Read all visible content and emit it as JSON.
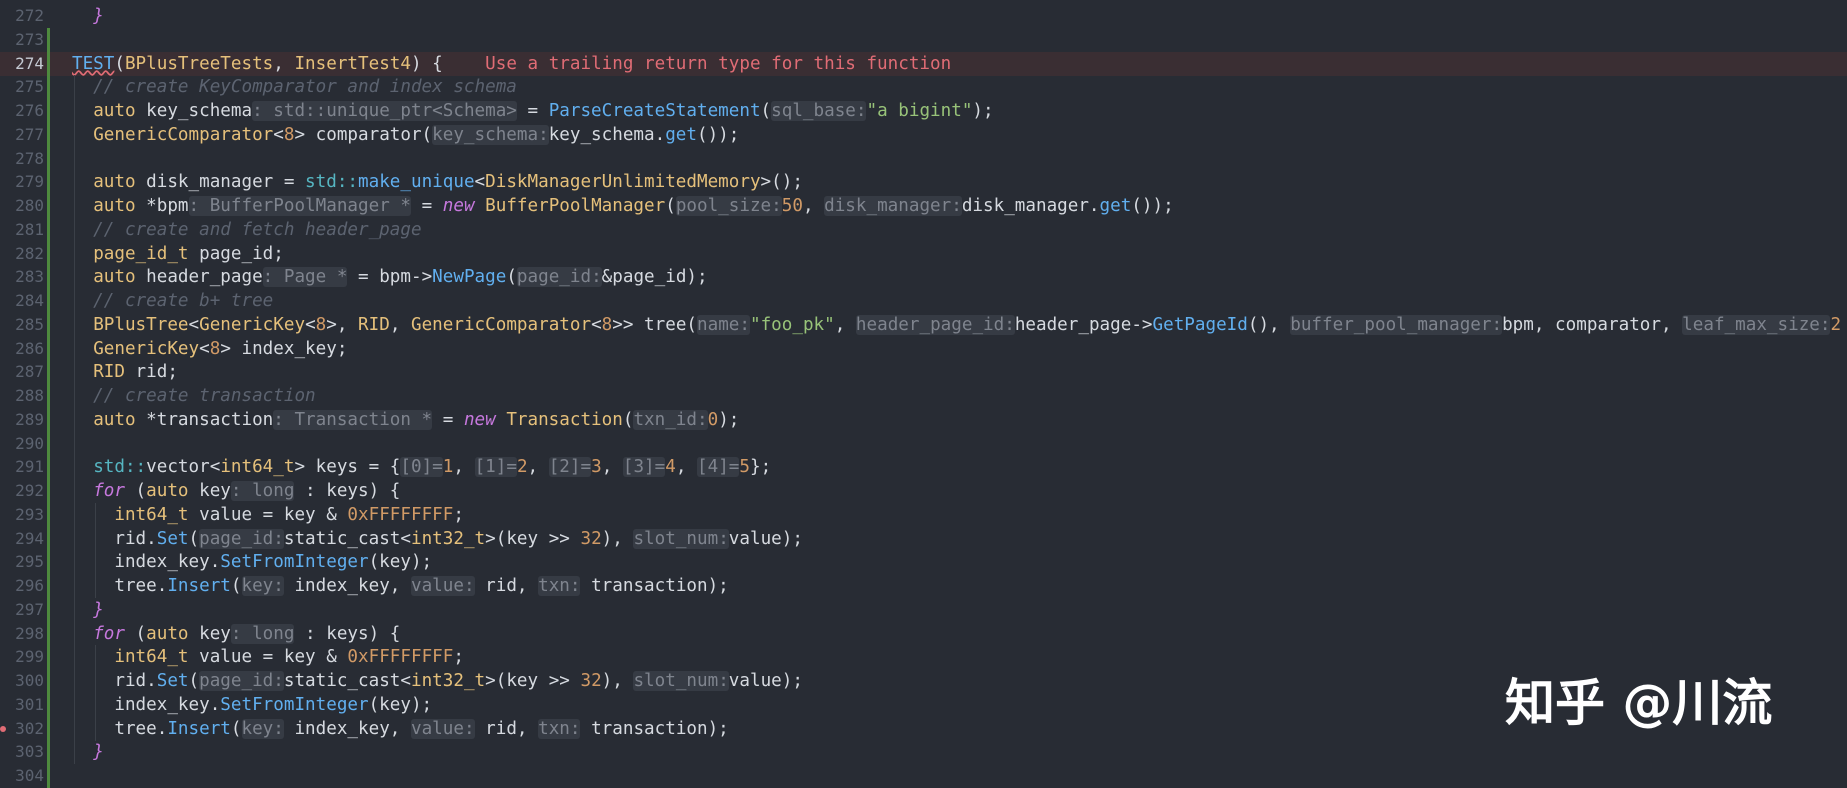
{
  "editor": {
    "lines": [
      {
        "n": "272",
        "tokens": [
          [
            "t-text",
            "  "
          ],
          [
            "t-kwi",
            "}"
          ]
        ]
      },
      {
        "n": "273",
        "tokens": []
      },
      {
        "n": "274",
        "active": true,
        "tokens": [
          [
            "t-macro",
            "TEST"
          ],
          [
            "t-text",
            "("
          ],
          [
            "t-type",
            "BPlusTreeTests"
          ],
          [
            "t-text",
            ", "
          ],
          [
            "t-type",
            "InsertTest4"
          ],
          [
            "t-text",
            ") {    "
          ],
          [
            "t-err",
            "Use a trailing return type for this function"
          ]
        ]
      },
      {
        "n": "275",
        "tokens": [
          [
            "t-com",
            "  // create KeyComparator and index schema"
          ]
        ]
      },
      {
        "n": "276",
        "tokens": [
          [
            "t-text",
            "  "
          ],
          [
            "t-kw",
            "auto"
          ],
          [
            "t-text",
            " key_schema"
          ],
          [
            "t-hint",
            ": std::unique_ptr<Schema>"
          ],
          [
            "t-text",
            " = "
          ],
          [
            "t-fn",
            "ParseCreateStatement"
          ],
          [
            "t-text",
            "("
          ],
          [
            "t-hint",
            "sql_base:"
          ],
          [
            "t-str",
            "\"a bigint\""
          ],
          [
            "t-text",
            ");"
          ]
        ]
      },
      {
        "n": "277",
        "tokens": [
          [
            "t-text",
            "  "
          ],
          [
            "t-type",
            "GenericComparator"
          ],
          [
            "t-text",
            "<"
          ],
          [
            "t-num",
            "8"
          ],
          [
            "t-text",
            "> comparator("
          ],
          [
            "t-hint",
            "key_schema:"
          ],
          [
            "t-text",
            "key_schema."
          ],
          [
            "t-fn",
            "get"
          ],
          [
            "t-text",
            "());"
          ]
        ]
      },
      {
        "n": "278",
        "tokens": []
      },
      {
        "n": "279",
        "tokens": [
          [
            "t-text",
            "  "
          ],
          [
            "t-kw",
            "auto"
          ],
          [
            "t-text",
            " disk_manager = "
          ],
          [
            "t-ns",
            "std::"
          ],
          [
            "t-fn",
            "make_unique"
          ],
          [
            "t-text",
            "<"
          ],
          [
            "t-type",
            "DiskManagerUnlimitedMemory"
          ],
          [
            "t-text",
            ">();"
          ]
        ]
      },
      {
        "n": "280",
        "tokens": [
          [
            "t-text",
            "  "
          ],
          [
            "t-kw",
            "auto"
          ],
          [
            "t-text",
            " *bpm"
          ],
          [
            "t-hint",
            ": BufferPoolManager *"
          ],
          [
            "t-text",
            " = "
          ],
          [
            "t-kwi",
            "new"
          ],
          [
            "t-text",
            " "
          ],
          [
            "t-type",
            "BufferPoolManager"
          ],
          [
            "t-text",
            "("
          ],
          [
            "t-hint",
            "pool_size:"
          ],
          [
            "t-num",
            "50"
          ],
          [
            "t-text",
            ", "
          ],
          [
            "t-hint",
            "disk_manager:"
          ],
          [
            "t-text",
            "disk_manager."
          ],
          [
            "t-fn",
            "get"
          ],
          [
            "t-text",
            "());"
          ]
        ]
      },
      {
        "n": "281",
        "tokens": [
          [
            "t-com",
            "  // create and fetch header_page"
          ]
        ]
      },
      {
        "n": "282",
        "tokens": [
          [
            "t-text",
            "  "
          ],
          [
            "t-type",
            "page_id_t"
          ],
          [
            "t-text",
            " page_id;"
          ]
        ]
      },
      {
        "n": "283",
        "tokens": [
          [
            "t-text",
            "  "
          ],
          [
            "t-kw",
            "auto"
          ],
          [
            "t-text",
            " header_page"
          ],
          [
            "t-hint",
            ": Page *"
          ],
          [
            "t-text",
            " = bpm->"
          ],
          [
            "t-fn",
            "NewPage"
          ],
          [
            "t-text",
            "("
          ],
          [
            "t-hint",
            "page_id:"
          ],
          [
            "t-text",
            "&page_id);"
          ]
        ]
      },
      {
        "n": "284",
        "tokens": [
          [
            "t-com",
            "  // create b+ tree"
          ]
        ]
      },
      {
        "n": "285",
        "tokens": [
          [
            "t-text",
            "  "
          ],
          [
            "t-type",
            "BPlusTree"
          ],
          [
            "t-text",
            "<"
          ],
          [
            "t-type",
            "GenericKey"
          ],
          [
            "t-text",
            "<"
          ],
          [
            "t-num",
            "8"
          ],
          [
            "t-text",
            ">, "
          ],
          [
            "t-type",
            "RID"
          ],
          [
            "t-text",
            ", "
          ],
          [
            "t-type",
            "GenericComparator"
          ],
          [
            "t-text",
            "<"
          ],
          [
            "t-num",
            "8"
          ],
          [
            "t-text",
            ">> tree("
          ],
          [
            "t-hint",
            "name:"
          ],
          [
            "t-str",
            "\"foo_pk\""
          ],
          [
            "t-text",
            ", "
          ],
          [
            "t-hint",
            "header_page_id:"
          ],
          [
            "t-text",
            "header_page->"
          ],
          [
            "t-fn",
            "GetPageId"
          ],
          [
            "t-text",
            "(), "
          ],
          [
            "t-hint",
            "buffer_pool_manager:"
          ],
          [
            "t-text",
            "bpm, comparator, "
          ],
          [
            "t-hint",
            "leaf_max_size:"
          ],
          [
            "t-num",
            "2"
          ]
        ]
      },
      {
        "n": "286",
        "tokens": [
          [
            "t-text",
            "  "
          ],
          [
            "t-type",
            "GenericKey"
          ],
          [
            "t-text",
            "<"
          ],
          [
            "t-num",
            "8"
          ],
          [
            "t-text",
            "> index_key;"
          ]
        ]
      },
      {
        "n": "287",
        "tokens": [
          [
            "t-text",
            "  "
          ],
          [
            "t-type",
            "RID"
          ],
          [
            "t-text",
            " rid;"
          ]
        ]
      },
      {
        "n": "288",
        "tokens": [
          [
            "t-com",
            "  // create transaction"
          ]
        ]
      },
      {
        "n": "289",
        "tokens": [
          [
            "t-text",
            "  "
          ],
          [
            "t-kw",
            "auto"
          ],
          [
            "t-text",
            " *transaction"
          ],
          [
            "t-hint",
            ": Transaction *"
          ],
          [
            "t-text",
            " = "
          ],
          [
            "t-kwi",
            "new"
          ],
          [
            "t-text",
            " "
          ],
          [
            "t-type",
            "Transaction"
          ],
          [
            "t-text",
            "("
          ],
          [
            "t-hint",
            "txn_id:"
          ],
          [
            "t-num",
            "0"
          ],
          [
            "t-text",
            ");"
          ]
        ]
      },
      {
        "n": "290",
        "tokens": []
      },
      {
        "n": "291",
        "tokens": [
          [
            "t-text",
            "  "
          ],
          [
            "t-ns",
            "std::"
          ],
          [
            "t-text",
            "vector<"
          ],
          [
            "t-type",
            "int64_t"
          ],
          [
            "t-text",
            "> keys = {"
          ],
          [
            "t-hint",
            "[0]="
          ],
          [
            "t-num",
            "1"
          ],
          [
            "t-text",
            ", "
          ],
          [
            "t-hint",
            "[1]="
          ],
          [
            "t-num",
            "2"
          ],
          [
            "t-text",
            ", "
          ],
          [
            "t-hint",
            "[2]="
          ],
          [
            "t-num",
            "3"
          ],
          [
            "t-text",
            ", "
          ],
          [
            "t-hint",
            "[3]="
          ],
          [
            "t-num",
            "4"
          ],
          [
            "t-text",
            ", "
          ],
          [
            "t-hint",
            "[4]="
          ],
          [
            "t-num",
            "5"
          ],
          [
            "t-text",
            "};"
          ]
        ]
      },
      {
        "n": "292",
        "tokens": [
          [
            "t-text",
            "  "
          ],
          [
            "t-kwi",
            "for"
          ],
          [
            "t-text",
            " ("
          ],
          [
            "t-kw",
            "auto"
          ],
          [
            "t-text",
            " key"
          ],
          [
            "t-hint",
            ": long"
          ],
          [
            "t-text",
            " : keys) {"
          ]
        ]
      },
      {
        "n": "293",
        "tokens": [
          [
            "t-text",
            "    "
          ],
          [
            "t-type",
            "int64_t"
          ],
          [
            "t-text",
            " value = key & "
          ],
          [
            "t-num",
            "0xFFFFFFFF"
          ],
          [
            "t-text",
            ";"
          ]
        ]
      },
      {
        "n": "294",
        "tokens": [
          [
            "t-text",
            "    rid."
          ],
          [
            "t-fn",
            "Set"
          ],
          [
            "t-text",
            "("
          ],
          [
            "t-hint",
            "page_id:"
          ],
          [
            "t-text",
            "static_cast<"
          ],
          [
            "t-type",
            "int32_t"
          ],
          [
            "t-text",
            ">(key >> "
          ],
          [
            "t-num",
            "32"
          ],
          [
            "t-text",
            "), "
          ],
          [
            "t-hint",
            "slot_num:"
          ],
          [
            "t-text",
            "value);"
          ]
        ]
      },
      {
        "n": "295",
        "tokens": [
          [
            "t-text",
            "    index_key."
          ],
          [
            "t-fn",
            "SetFromInteger"
          ],
          [
            "t-text",
            "(key);"
          ]
        ]
      },
      {
        "n": "296",
        "tokens": [
          [
            "t-text",
            "    tree."
          ],
          [
            "t-fn",
            "Insert"
          ],
          [
            "t-text",
            "("
          ],
          [
            "t-hint",
            "key:"
          ],
          [
            "t-text",
            " index_key, "
          ],
          [
            "t-hint",
            "value:"
          ],
          [
            "t-text",
            " rid, "
          ],
          [
            "t-hint",
            "txn:"
          ],
          [
            "t-text",
            " transaction);"
          ]
        ]
      },
      {
        "n": "297",
        "tokens": [
          [
            "t-text",
            "  "
          ],
          [
            "t-kwi",
            "}"
          ]
        ]
      },
      {
        "n": "298",
        "tokens": [
          [
            "t-text",
            "  "
          ],
          [
            "t-kwi",
            "for"
          ],
          [
            "t-text",
            " ("
          ],
          [
            "t-kw",
            "auto"
          ],
          [
            "t-text",
            " key"
          ],
          [
            "t-hint",
            ": long"
          ],
          [
            "t-text",
            " : keys) {"
          ]
        ]
      },
      {
        "n": "299",
        "tokens": [
          [
            "t-text",
            "    "
          ],
          [
            "t-type",
            "int64_t"
          ],
          [
            "t-text",
            " value = key & "
          ],
          [
            "t-num",
            "0xFFFFFFFF"
          ],
          [
            "t-text",
            ";"
          ]
        ]
      },
      {
        "n": "300",
        "tokens": [
          [
            "t-text",
            "    rid."
          ],
          [
            "t-fn",
            "Set"
          ],
          [
            "t-text",
            "("
          ],
          [
            "t-hint",
            "page_id:"
          ],
          [
            "t-text",
            "static_cast<"
          ],
          [
            "t-type",
            "int32_t"
          ],
          [
            "t-text",
            ">(key >> "
          ],
          [
            "t-num",
            "32"
          ],
          [
            "t-text",
            "), "
          ],
          [
            "t-hint",
            "slot_num:"
          ],
          [
            "t-text",
            "value);"
          ]
        ]
      },
      {
        "n": "301",
        "tokens": [
          [
            "t-text",
            "    index_key."
          ],
          [
            "t-fn",
            "SetFromInteger"
          ],
          [
            "t-text",
            "(key);"
          ]
        ]
      },
      {
        "n": "302",
        "breakpoint": true,
        "tokens": [
          [
            "t-text",
            "    tree."
          ],
          [
            "t-fn",
            "Insert"
          ],
          [
            "t-text",
            "("
          ],
          [
            "t-hint",
            "key:"
          ],
          [
            "t-text",
            " index_key, "
          ],
          [
            "t-hint",
            "value:"
          ],
          [
            "t-text",
            " rid, "
          ],
          [
            "t-hint",
            "txn:"
          ],
          [
            "t-text",
            " transaction);"
          ]
        ]
      },
      {
        "n": "303",
        "tokens": [
          [
            "t-text",
            "  "
          ],
          [
            "t-kwi",
            "}"
          ]
        ]
      },
      {
        "n": "304",
        "tokens": []
      }
    ]
  },
  "watermark": {
    "text": "知乎 @川流"
  }
}
